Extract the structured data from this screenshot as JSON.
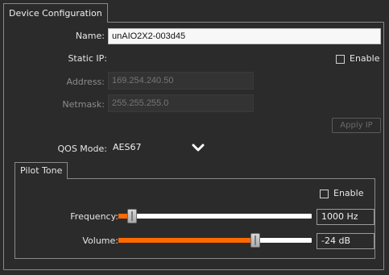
{
  "device_config": {
    "tab_label": "Device Configuration",
    "name_label": "Name:",
    "name_value": "unAIO2X2-003d45",
    "static_ip_label": "Static IP:",
    "static_ip_enable_label": "Enable",
    "static_ip_enabled": false,
    "address_label": "Address:",
    "address_placeholder": "169.254.240.50",
    "netmask_label": "Netmask:",
    "netmask_placeholder": "255.255.255.0",
    "apply_ip_label": "Apply IP",
    "qos_label": "QOS Mode:",
    "qos_value": "AES67"
  },
  "pilot_tone": {
    "tab_label": "Pilot Tone",
    "enable_label": "Enable",
    "enabled": false,
    "frequency_label": "Frequency:",
    "frequency_value": "1000 Hz",
    "frequency_fraction": 0.05,
    "volume_label": "Volume:",
    "volume_value": "-24 dB",
    "volume_fraction": 0.72
  },
  "colors": {
    "accent": "#ff6a00",
    "background": "#2b2b2b",
    "border": "#8a8a8a"
  },
  "icons": {
    "qos_dropdown": "chevron-down-icon"
  }
}
